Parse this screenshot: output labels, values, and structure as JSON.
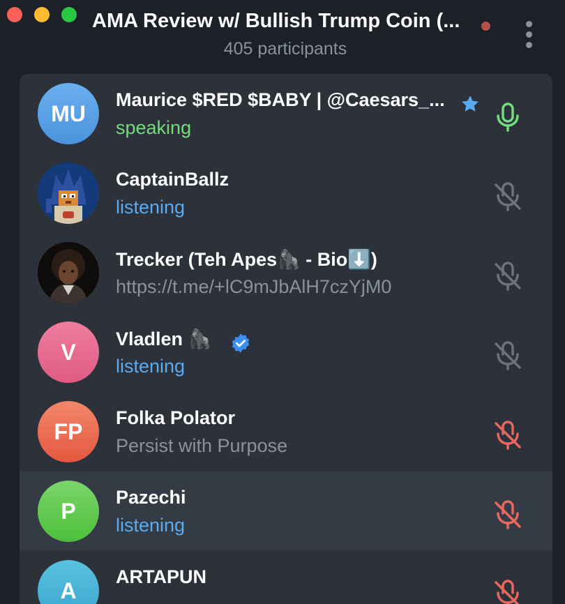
{
  "window": {
    "title": "AMA Review w/ Bullish Trump Coin (...",
    "subtitle": "405 participants"
  },
  "colors": {
    "speaking": "#73dd7c",
    "listening": "#5aabef",
    "muted_by_admin": "#e8685f",
    "muted_self": "#6c737d",
    "live_dot": "#b5504f"
  },
  "participants": [
    {
      "name": "Maurice $RED $BABY | @Caesars_...",
      "initials": "MU",
      "status": "speaking",
      "badge": "star-icon",
      "mic": "mic-active-icon"
    },
    {
      "name": "CaptainBallz",
      "initials": "",
      "status": "listening",
      "avatar": "pixel-art-avatar",
      "mic": "mic-muted-icon"
    },
    {
      "name": "Trecker (Teh Apes🦍 - Bio⬇️)",
      "initials": "",
      "status": "https://t.me/+lC9mJbAlH7czYjM0",
      "avatar": "portrait-avatar",
      "mic": "mic-muted-icon"
    },
    {
      "name": "Vladlen 🦍",
      "initials": "V",
      "status": "listening",
      "badge": "verified-icon",
      "mic": "mic-muted-icon"
    },
    {
      "name": "Folka Polator",
      "initials": "FP",
      "status": "Persist with Purpose",
      "mic": "mic-muted-red-icon"
    },
    {
      "name": "Pazechi",
      "initials": "P",
      "status": "listening",
      "mic": "mic-muted-red-icon"
    },
    {
      "name": "ARTAPUN",
      "initials": "A",
      "status": "",
      "mic": "mic-muted-red-icon"
    }
  ]
}
